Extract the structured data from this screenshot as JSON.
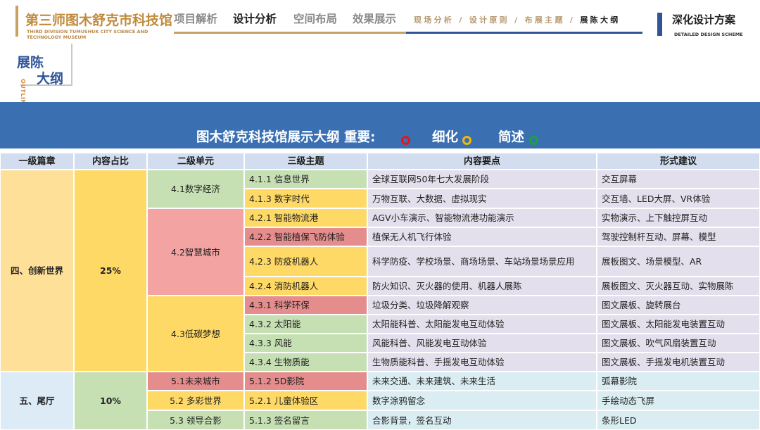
{
  "header": {
    "brand_cn": "第三师图木舒克市科技馆",
    "brand_en": "THIRD DIVISION TUMUSHUK CITY SCIENCE AND TECHNOLOGY MUSEUM",
    "nav": [
      "项目解析",
      "设计分析",
      "空间布局",
      "效果展示"
    ],
    "active_nav": "设计分析",
    "crumbs": [
      "现场分析",
      "设计原则",
      "布展主题"
    ],
    "crumb_current": "展陈大纲",
    "scheme_cn": "深化设计方案",
    "scheme_en": "DETAILED DESIGN SCHEME"
  },
  "outline": {
    "t1": "展陈",
    "t2": "大纲",
    "en": "OUTLINE"
  },
  "banner": {
    "title": "图木舒克科技馆展示大纲 重要:",
    "label_detail": "细化",
    "label_brief": "简述",
    "colors": {
      "important": "#e8141c",
      "detail": "#f5b800",
      "brief": "#1aa33c",
      "background": "#3a70b1"
    }
  },
  "table": {
    "headers": [
      "一级篇章",
      "内容占比",
      "二级单元",
      "三级主题",
      "内容要点",
      "形式建议"
    ],
    "chapters": [
      {
        "name": "四、创新世界",
        "ratio": "25%"
      },
      {
        "name": "五、尾厅",
        "ratio": "10%"
      }
    ],
    "units": [
      "4.1数字经济",
      "4.2智慧城市",
      "4.3低碳梦想",
      "5.1未来城市",
      "5.2 多彩世界",
      "5.3 领导合影"
    ],
    "rows": [
      {
        "theme": "4.1.1 信息世界",
        "points": "全球互联网50年七大发展阶段",
        "form": "交互屏幕"
      },
      {
        "theme": "4.1.3 数字时代",
        "points": "万物互联、大数据、虚拟现实",
        "form": "交互墙、LED大屏、VR体验"
      },
      {
        "theme": "4.2.1 智能物流港",
        "points": "AGV小车演示、智能物流港功能演示",
        "form": "实物演示、上下触控屏互动"
      },
      {
        "theme": "4.2.2 智能植保飞防体验",
        "points": "植保无人机飞行体验",
        "form": "驾驶控制杆互动、屏幕、模型"
      },
      {
        "theme": "4.2.3 防疫机器人",
        "points": "科学防疫、学校场景、商场场景、车站场景场景应用",
        "form": "展板图文、场景模型、AR"
      },
      {
        "theme": "4.2.4 消防机器人",
        "points": "防火知识、灭火器的使用、机器人展陈",
        "form": "展板图文、灭火器互动、实物展陈"
      },
      {
        "theme": "4.3.1 科学环保",
        "points": "垃圾分类、垃圾降解观察",
        "form": "图文展板、旋转展台"
      },
      {
        "theme": "4.3.2 太阳能",
        "points": "太阳能科普、太阳能发电互动体验",
        "form": "图文展板、太阳能发电装置互动"
      },
      {
        "theme": "4.3.3 风能",
        "points": "风能科普、风能发电互动体验",
        "form": "图文展板、吹气风扇装置互动"
      },
      {
        "theme": "4.3.4 生物质能",
        "points": "生物质能科普、手摇发电互动体验",
        "form": "图文展板、手摇发电机装置互动"
      },
      {
        "theme": "5.1.2 5D影院",
        "points": "未来交通、未来建筑、未来生活",
        "form": "弧幕影院"
      },
      {
        "theme": "5.2.1 儿童体验区",
        "points": "数字涂鸦留念",
        "form": "手绘动态飞屏"
      },
      {
        "theme": "5.1.3 签名留言",
        "points": "合影背景，签名互动",
        "form": "条形LED"
      }
    ],
    "colors": {
      "header": "#d2deef",
      "chapter": "#ffe099",
      "ratio": "#ffd966",
      "green": "#c6e0b4",
      "pink": "#f4a3a3",
      "rose": "#e58c8c",
      "yellow": "#ffd966",
      "lavender": "#e4dfec",
      "chapter2": "#ddebf7",
      "light_blue": "#d9edf3"
    }
  }
}
